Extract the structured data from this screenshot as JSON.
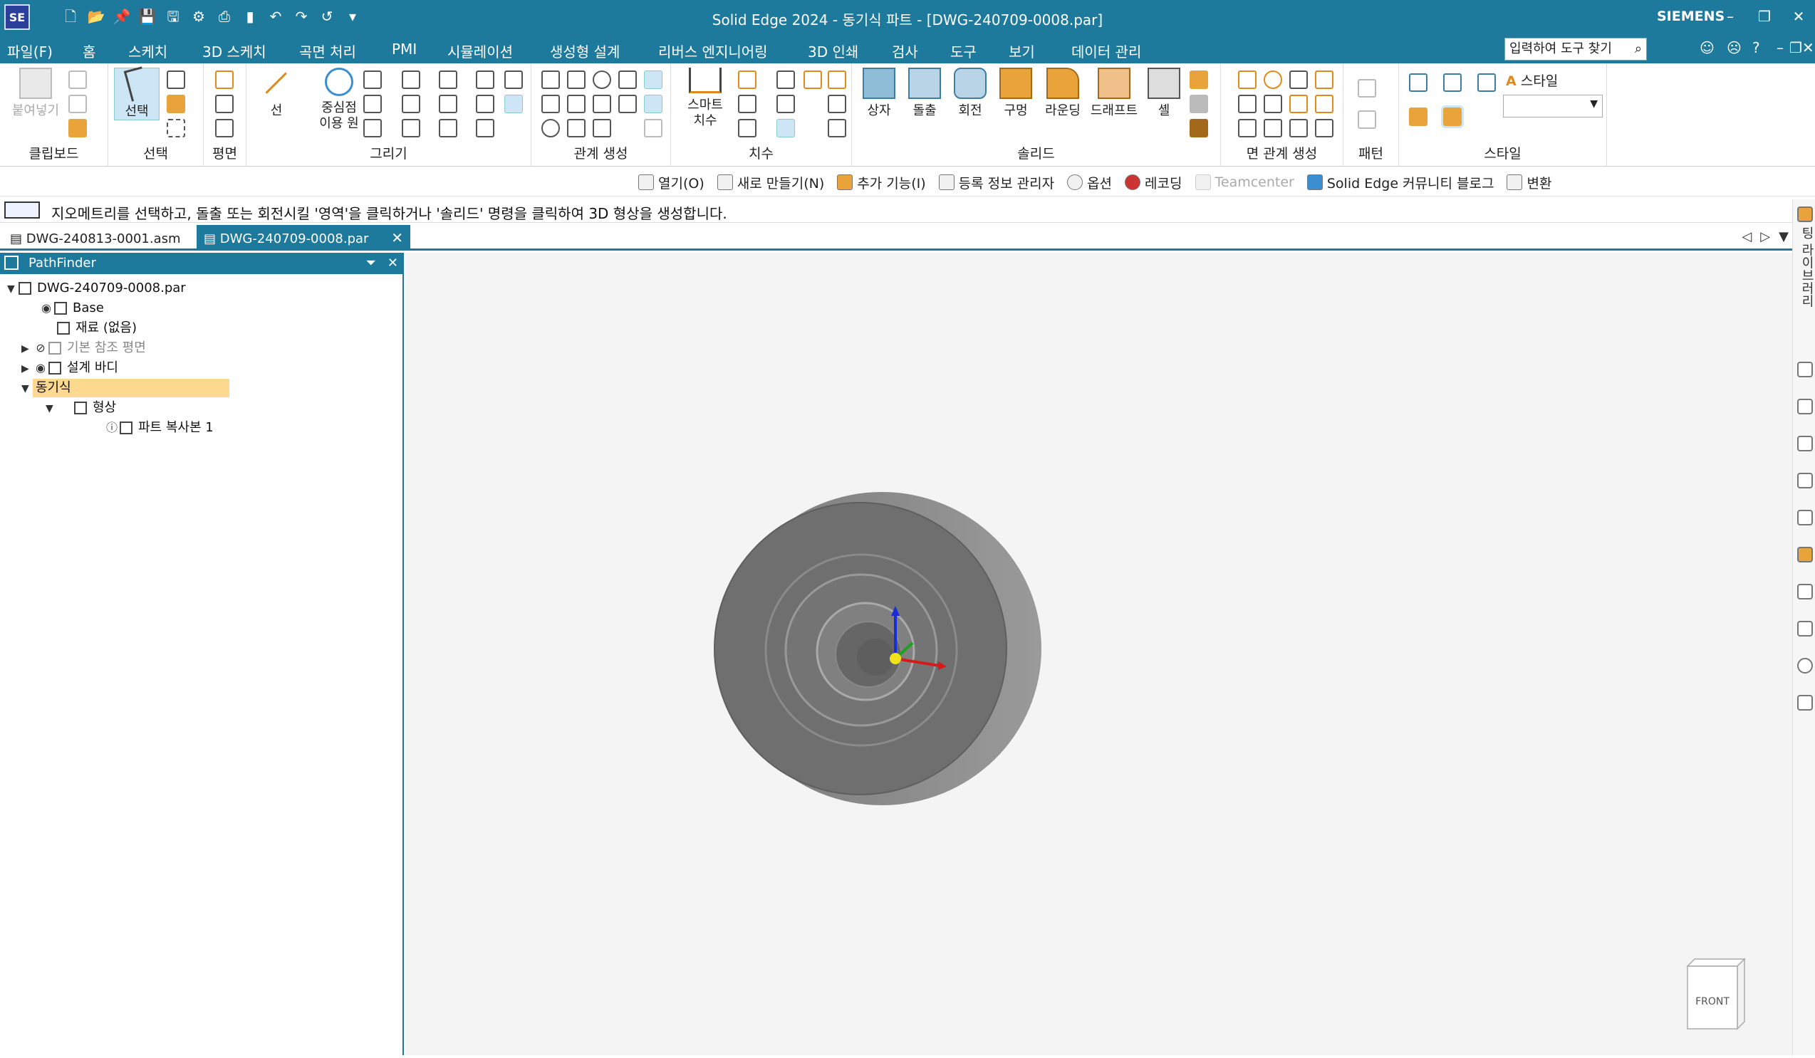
{
  "titlebar": {
    "logo": "SE",
    "title": "Solid Edge 2024 - 동기식 파트 - [DWG-240709-0008.par]",
    "brand": "SIEMENS"
  },
  "menubar": {
    "items": [
      "파일(F)",
      "홈",
      "스케치",
      "3D 스케치",
      "곡면 처리",
      "PMI",
      "시뮬레이션",
      "생성형 설계",
      "리버스 엔지니어링",
      "3D 인쇄",
      "검사",
      "도구",
      "보기",
      "데이터 관리"
    ],
    "active": "홈",
    "search_placeholder": "입력하여 도구 찾기"
  },
  "ribbon": {
    "groups": {
      "clipboard": "클립보드",
      "select": "선택",
      "plane": "평면",
      "draw": "그리기",
      "relate": "관계 생성",
      "dimension": "치수",
      "solid": "솔리드",
      "face_relate": "면 관계 생성",
      "pattern": "패턴",
      "style": "스타일"
    },
    "buttons": {
      "paste": "붙여넣기",
      "select": "선택",
      "line": "선",
      "center_circle_1": "중심점",
      "center_circle_2": "이용 원",
      "smart_dim_1": "스마트",
      "smart_dim_2": "치수",
      "box": "상자",
      "extrude": "돌출",
      "revolve": "회전",
      "hole": "구멍",
      "round": "라운딩",
      "draft": "드래프트",
      "shell": "셸",
      "style": "스타일"
    }
  },
  "toolbar2": {
    "open": "열기(O)",
    "new": "새로 만들기(N)",
    "addins": "추가 기능(I)",
    "registry": "등록 정보 관리자",
    "options": "옵션",
    "recording": "레코딩",
    "teamcenter": "Teamcenter",
    "blog": "Solid Edge 커뮤니티 블로그",
    "convert": "변환"
  },
  "prompt": "지오메트리를 선택하고, 돌출 또는 회전시킬 '영역'을 클릭하거나 '솔리드' 명령을 클릭하여 3D 형상을 생성합니다.",
  "doc_tabs": [
    "DWG-240813-0001.asm",
    "DWG-240709-0008.par"
  ],
  "pathfinder": {
    "title": "PathFinder",
    "rows": [
      "DWG-240709-0008.par",
      "Base",
      "재료 (없음)",
      "기본 참조 평면",
      "설계 바디",
      "동기식",
      "형상",
      "파트 복사본 1"
    ]
  },
  "viewcube": {
    "face": "FRONT"
  },
  "rightbar": {
    "label": "팅 라이브러리"
  },
  "colors": {
    "accent": "#1d7a9c",
    "selection": "#fcd98f"
  }
}
